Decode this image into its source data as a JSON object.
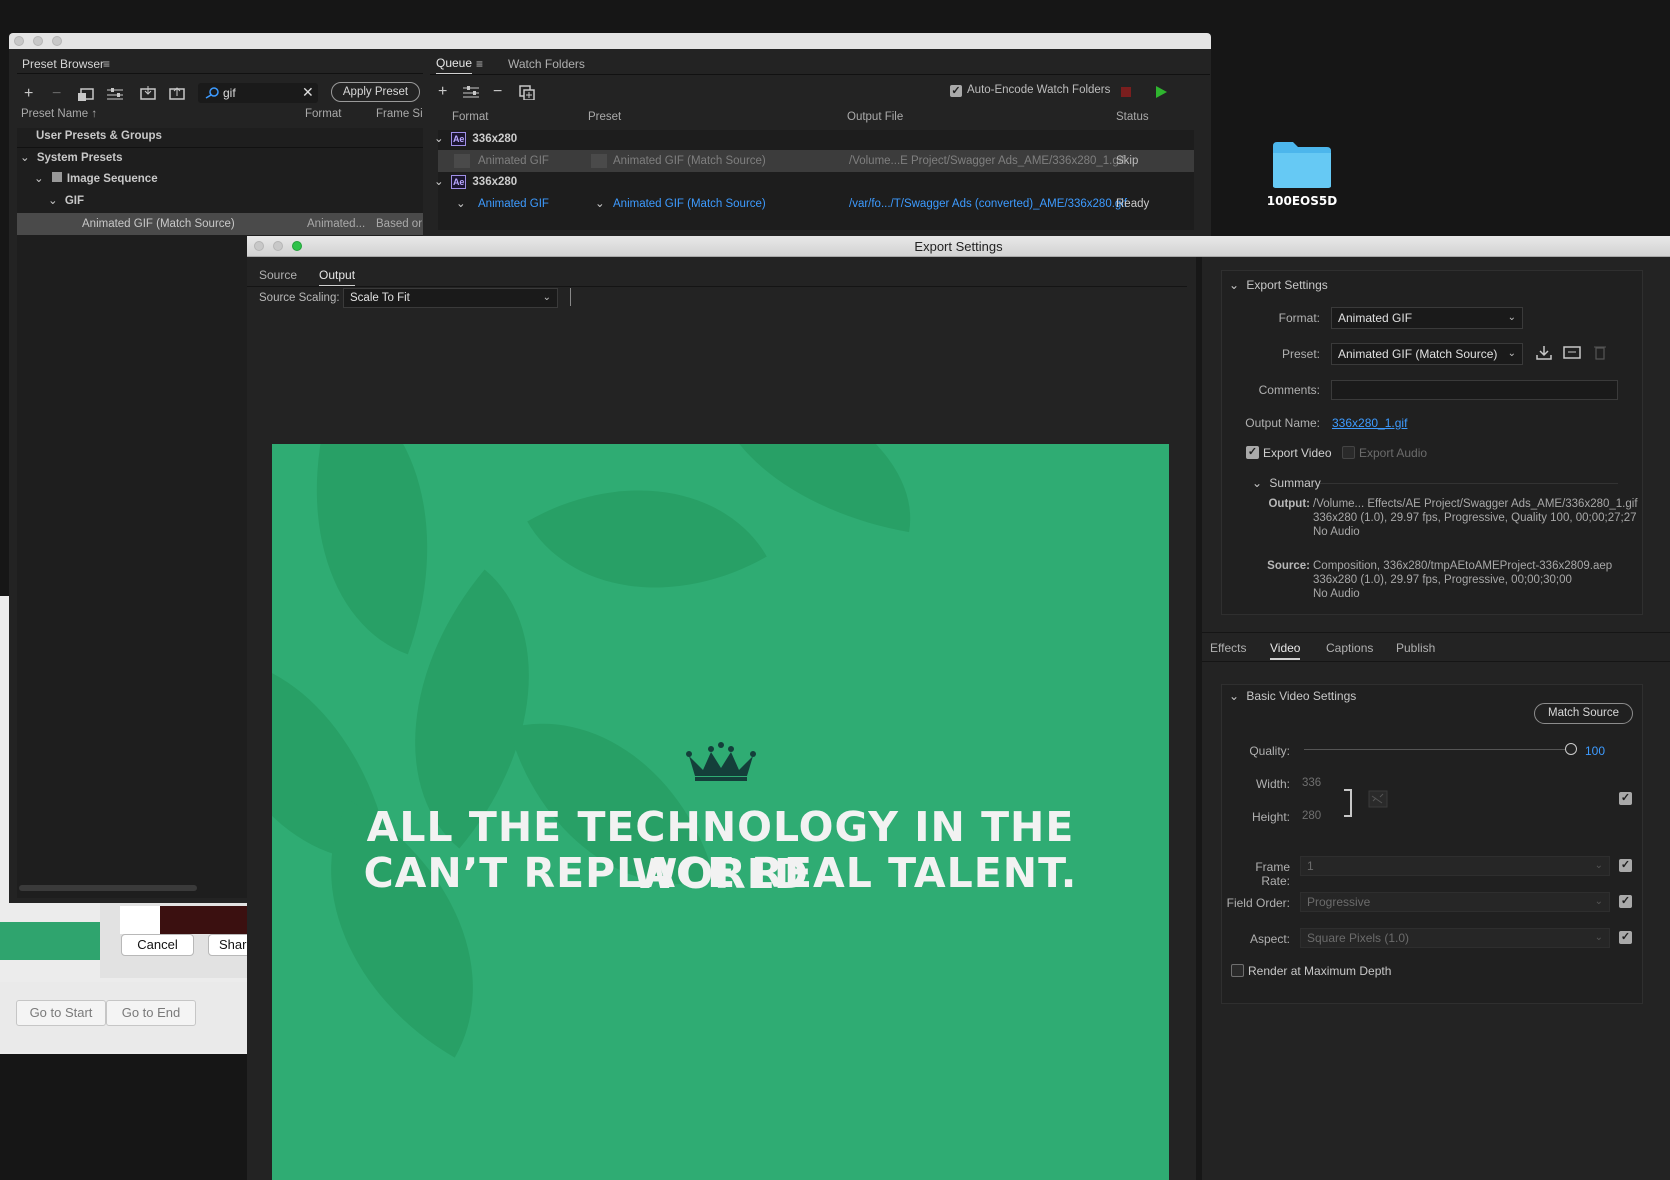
{
  "desktop": {
    "folder_name": "100EOS5D"
  },
  "background_dialog": {
    "cancel_label": "Cancel",
    "share_label": "Shar",
    "go_start_label": "Go to Start",
    "go_end_label": "Go to End"
  },
  "preset_browser": {
    "title": "Preset Browser",
    "search_value": "gif",
    "apply_label": "Apply Preset",
    "columns": {
      "name": "Preset Name",
      "format": "Format",
      "frame": "Frame Si"
    },
    "user_presets": "User Presets & Groups",
    "system_presets": "System Presets",
    "image_sequence": "Image Sequence",
    "gif": "GIF",
    "selected_preset": {
      "name": "Animated GIF (Match Source)",
      "format": "Animated...",
      "frame": "Based or"
    }
  },
  "queue": {
    "tab_queue": "Queue",
    "tab_watch": "Watch Folders",
    "auto_encode_label": "Auto-Encode Watch Folders",
    "columns": {
      "format": "Format",
      "preset": "Preset",
      "output": "Output File",
      "status": "Status"
    },
    "groups": [
      {
        "name": "336x280",
        "format": "Animated GIF",
        "preset": "Animated GIF (Match Source)",
        "output": "/Volume...E Project/Swagger Ads_AME/336x280_1.gif",
        "status": "Skip"
      },
      {
        "name": "336x280",
        "format": "Animated GIF",
        "preset": "Animated GIF (Match Source)",
        "output": "/var/fo.../T/Swagger Ads (converted)_AME/336x280.gif",
        "status": "Ready"
      }
    ]
  },
  "export": {
    "title": "Export Settings",
    "tab_source": "Source",
    "tab_output": "Output",
    "source_scaling_label": "Source Scaling:",
    "source_scaling_value": "Scale To Fit",
    "preview_line1": "ALL THE TECHNOLOGY IN THE WORLD",
    "preview_line2": "CAN’T REPLACE REAL TALENT.",
    "settings_header": "Export Settings",
    "format_label": "Format:",
    "format_value": "Animated GIF",
    "preset_label": "Preset:",
    "preset_value": "Animated GIF (Match Source)",
    "comments_label": "Comments:",
    "output_name_label": "Output Name:",
    "output_name_value": "336x280_1.gif",
    "export_video": "Export Video",
    "export_audio": "Export Audio",
    "summary_header": "Summary",
    "output_key": "Output:",
    "output_lines": [
      "/Volume... Effects/AE Project/Swagger Ads_AME/336x280_1.gif",
      "336x280 (1.0), 29.97 fps, Progressive, Quality 100, 00;00;27;27",
      "No Audio"
    ],
    "source_key": "Source:",
    "source_lines": [
      "Composition, 336x280/tmpAEtoAMEProject-336x2809.aep",
      "336x280 (1.0), 29.97 fps, Progressive, 00;00;30;00",
      "No Audio"
    ],
    "tabs": {
      "effects": "Effects",
      "video": "Video",
      "captions": "Captions",
      "publish": "Publish"
    },
    "basic_header": "Basic Video Settings",
    "match_source": "Match Source",
    "quality_label": "Quality:",
    "quality_value": "100",
    "width_label": "Width:",
    "width_value": "336",
    "height_label": "Height:",
    "height_value": "280",
    "frame_rate_label": "Frame Rate:",
    "frame_rate_value": "1",
    "field_order_label": "Field Order:",
    "field_order_value": "Progressive",
    "aspect_label": "Aspect:",
    "aspect_value": "Square Pixels (1.0)",
    "render_max_depth": "Render at Maximum Depth"
  }
}
